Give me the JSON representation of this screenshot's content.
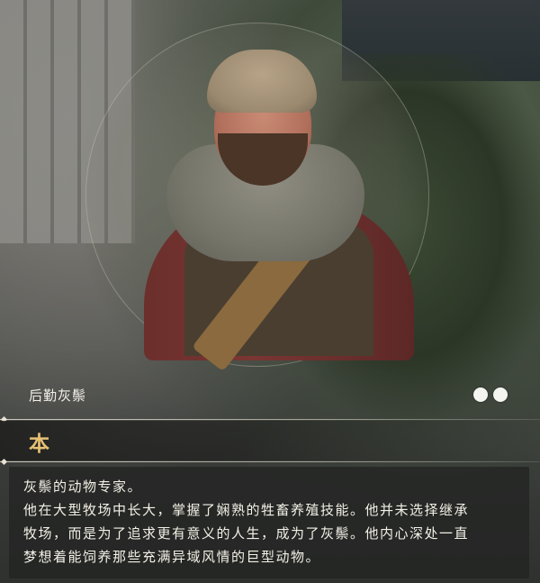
{
  "character": {
    "name": "后勤灰鬃",
    "class_glyph": "本",
    "indicators": [
      "filled",
      "filled"
    ]
  },
  "description": {
    "lines": [
      "灰鬃的动物专家。",
      "他在大型牧场中长大，掌握了娴熟的牲畜养殖技能。他并未选择继承",
      "牧场，而是为了追求更有意义的人生，成为了灰鬃。他内心深处一直",
      "梦想着能饲养那些充满异域风情的巨型动物。"
    ]
  },
  "colors": {
    "class_accent": "#e6c074",
    "text": "#f3f0e6"
  },
  "icons": [
    "diamond-marker-icon",
    "status-dot-icon"
  ]
}
